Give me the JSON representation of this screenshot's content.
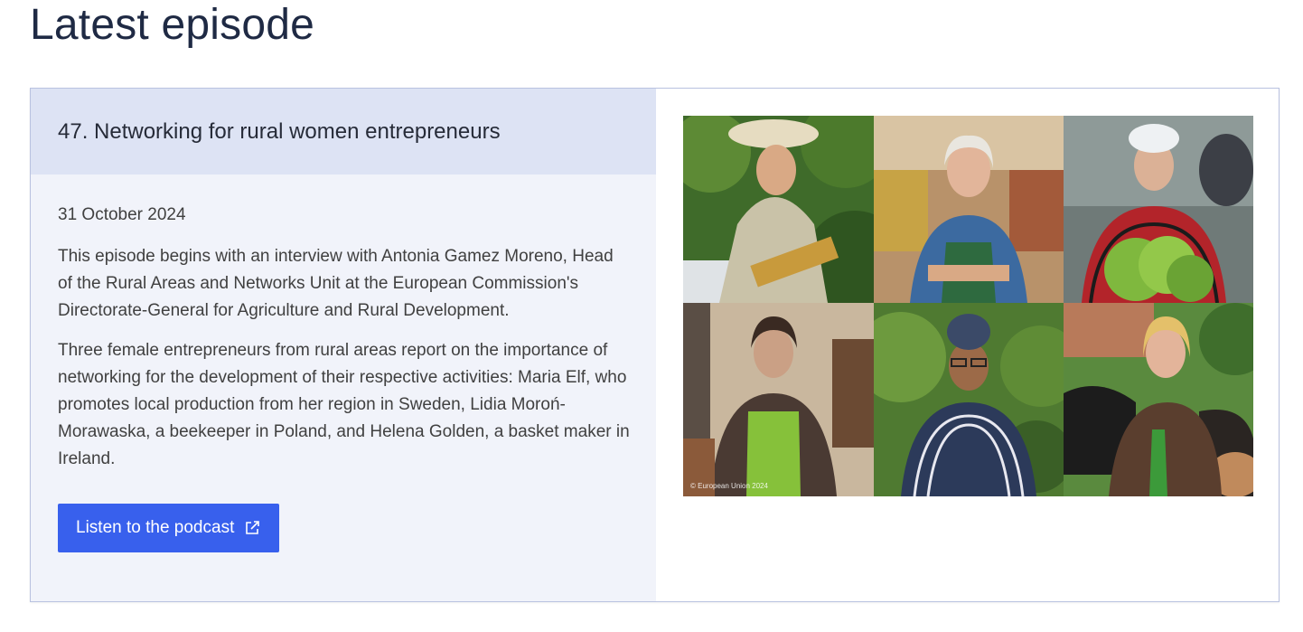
{
  "page": {
    "title": "Latest episode"
  },
  "episode": {
    "title": "47. Networking for rural women entrepreneurs",
    "date": "31 October 2024",
    "paragraphs": [
      "This episode begins with an interview with Antonia Gamez Moreno, Head of the Rural Areas and Networks Unit at the European Commission's Directorate-General for Agriculture and Rural Development.",
      "Three female entrepreneurs from rural areas report on the importance of networking for the development of their respective activities: Maria Elf, who promotes local production from her region in Sweden, Lidia Moroń-Morawaska, a beekeeper in Poland, and Helena Golden, a basket maker in Ireland."
    ],
    "button_label": "Listen to the podcast",
    "button_icon": "external-link-icon",
    "image_credit": "© European Union 2024"
  },
  "colors": {
    "title": "#1f2a44",
    "header_bg": "#dde3f4",
    "body_bg": "#f1f3fa",
    "button_bg": "#3860ed",
    "border": "#b9c2e0"
  }
}
